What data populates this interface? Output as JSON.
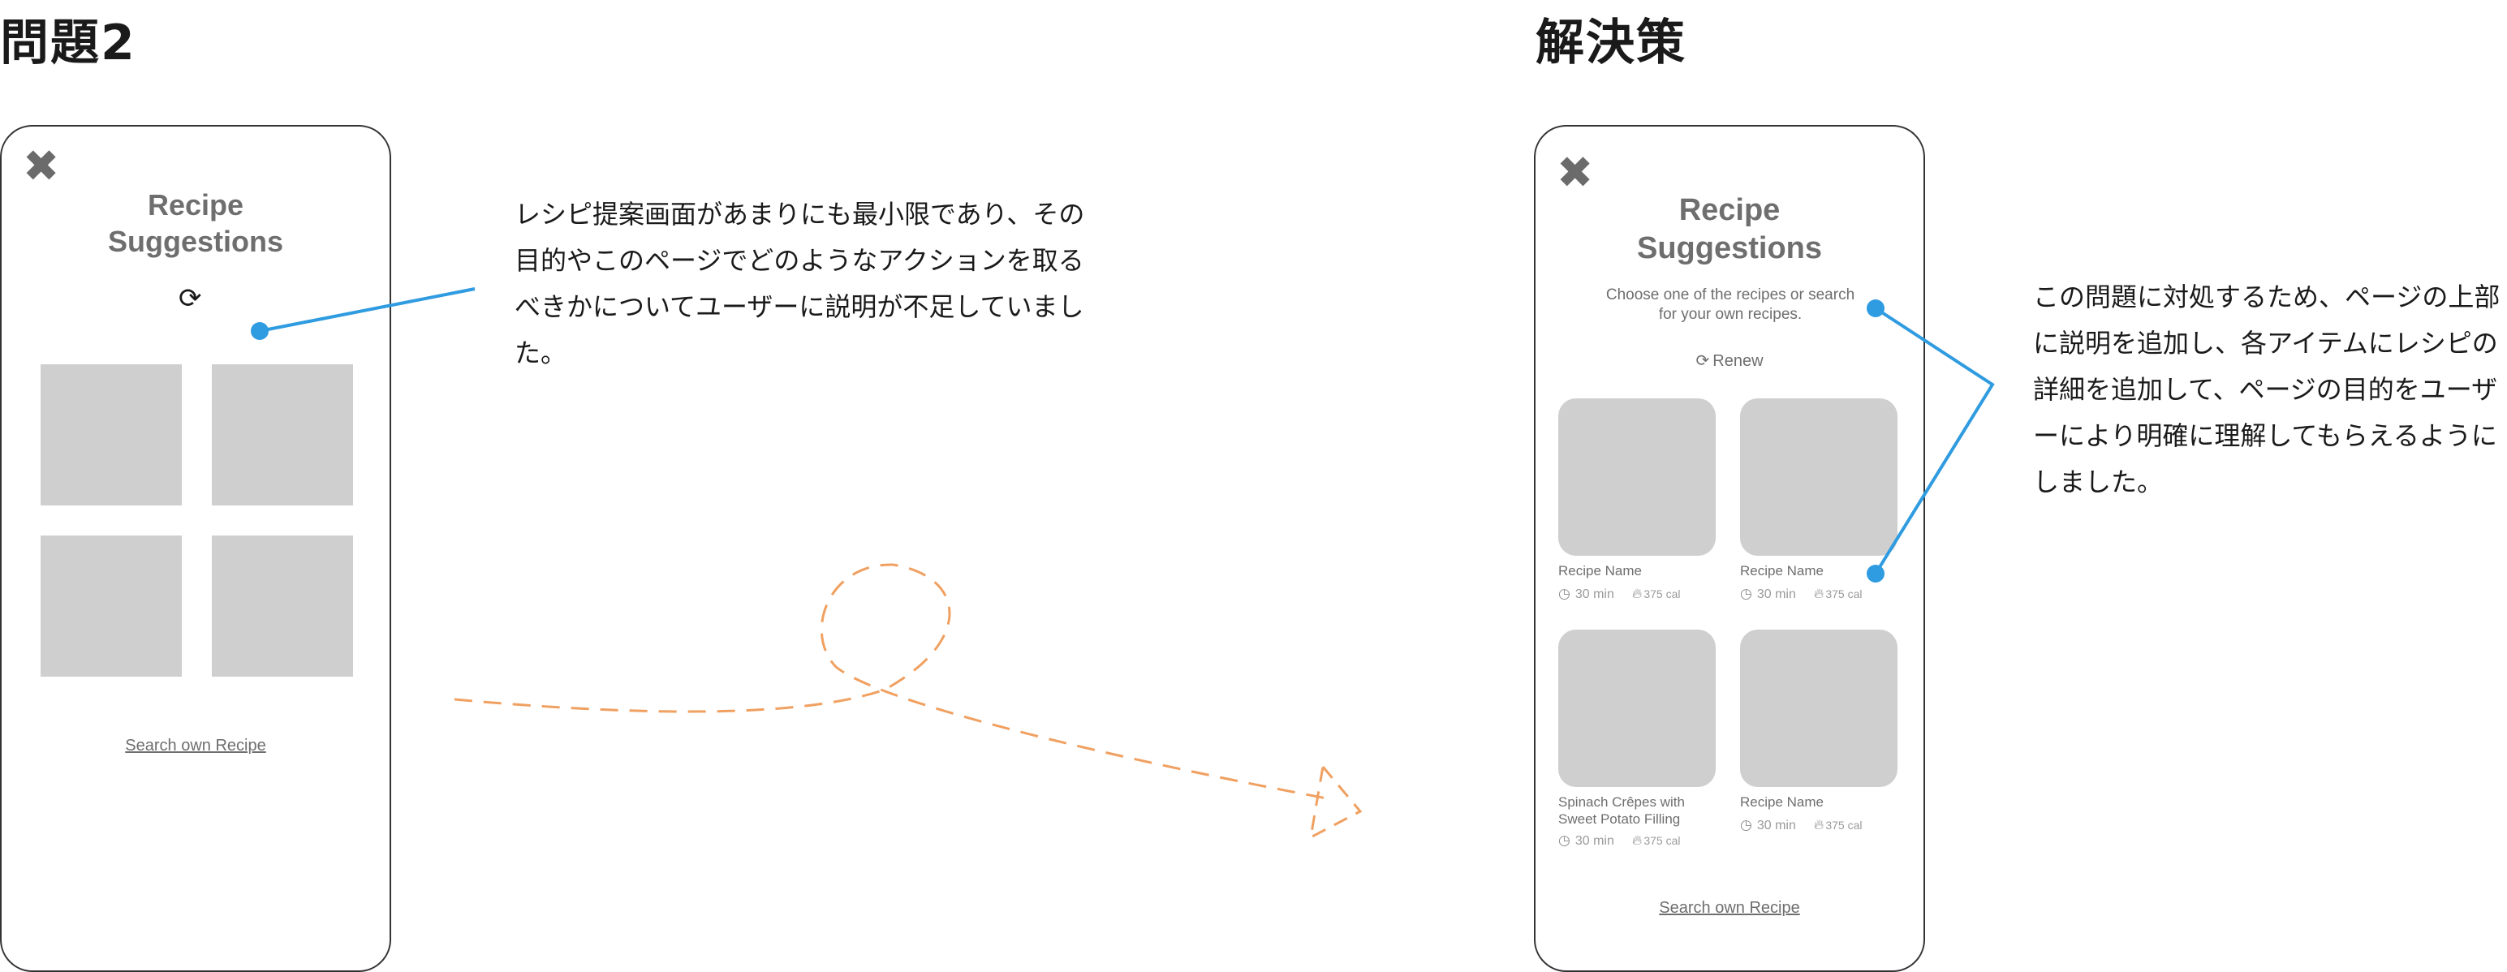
{
  "left": {
    "heading": "問題2",
    "title": "Recipe\nSuggestions",
    "search_link": "Search own Recipe",
    "note": "レシピ提案画面があまりにも最小限であり、その目的やこのページでどのようなアクションを取るべきかについてユーザーに説明が不足していました。"
  },
  "right": {
    "heading": "解決策",
    "title": "Recipe\nSuggestions",
    "subtitle": "Choose one of the recipes or search\nfor your own recipes.",
    "renew_label": "Renew",
    "cards": [
      {
        "name": "Recipe Name",
        "time": "30 min",
        "cal": "375 cal"
      },
      {
        "name": "Recipe Name",
        "time": "30 min",
        "cal": "375 cal"
      },
      {
        "name": "Spinach Crêpes with\nSweet Potato Filling",
        "time": "30 min",
        "cal": "375 cal"
      },
      {
        "name": "Recipe Name",
        "time": "30 min",
        "cal": "375 cal"
      }
    ],
    "search_link": "Search own Recipe",
    "note": "この問題に対処するため、ページの上部に説明を追加し、各アイテムにレシピの詳細を追加して、ページの目的をユーザーにより明確に理解してもらえるようにしました。"
  },
  "colors": {
    "connector": "#2f9be0",
    "arrow": "#f0a060",
    "tile": "#cfcfcf",
    "text_gray": "#6e6e6e"
  },
  "icons": {
    "close": "close-icon",
    "refresh": "refresh-icon",
    "clock": "clock-icon",
    "flame": "flame-icon"
  }
}
